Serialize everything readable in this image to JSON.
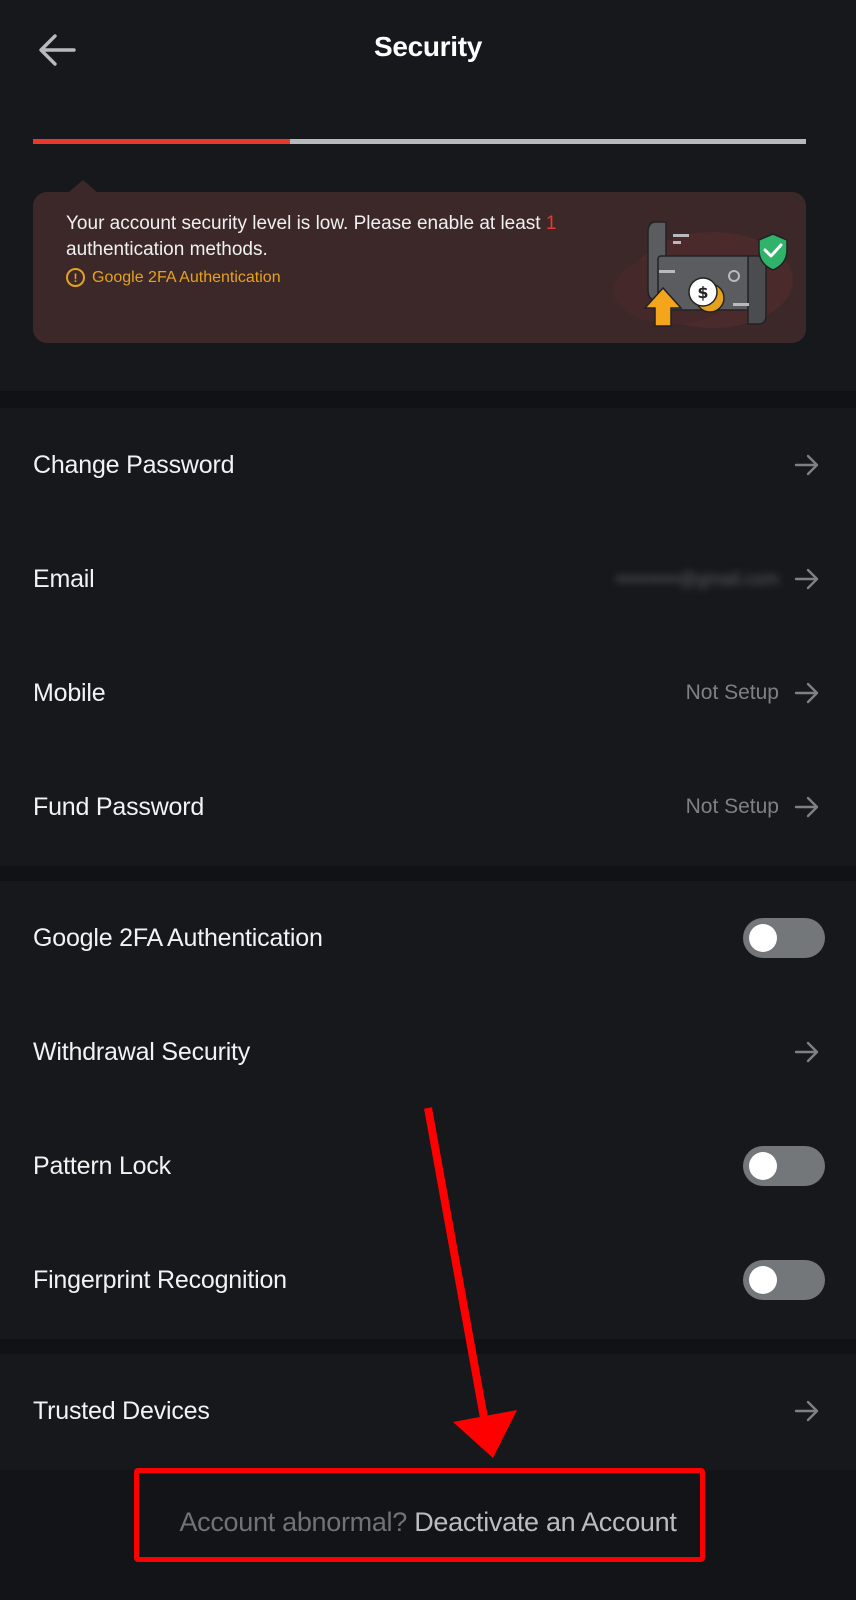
{
  "header": {
    "title": "Security",
    "back_icon": "arrow-left-icon"
  },
  "security_level": {
    "progress_fraction": 0.333,
    "fill_color": "#e8392f",
    "track_color": "#b7b9bd"
  },
  "alert": {
    "message_prefix": "Your account security level is low. Please enable at least ",
    "message_count": "1",
    "message_suffix": " authentication methods.",
    "link_label": "Google 2FA Authentication",
    "link_icon": "warning-circle-icon",
    "illustration": "wallet-shield-upgrade-illustration"
  },
  "sections": [
    {
      "rows": [
        {
          "label": "Change Password",
          "value": "",
          "control": "arrow"
        },
        {
          "label": "Email",
          "value": "••••••••••@gmail.com",
          "value_blurred": true,
          "control": "arrow"
        },
        {
          "label": "Mobile",
          "value": "Not Setup",
          "control": "arrow"
        },
        {
          "label": "Fund Password",
          "value": "Not Setup",
          "control": "arrow"
        }
      ]
    },
    {
      "rows": [
        {
          "label": "Google 2FA Authentication",
          "control": "toggle",
          "enabled": false
        },
        {
          "label": "Withdrawal Security",
          "control": "arrow"
        },
        {
          "label": "Pattern Lock",
          "control": "toggle",
          "enabled": false
        },
        {
          "label": "Fingerprint Recognition",
          "control": "toggle",
          "enabled": false
        }
      ]
    },
    {
      "rows": [
        {
          "label": "Trusted Devices",
          "control": "arrow"
        }
      ]
    }
  ],
  "footer": {
    "question": "Account abnormal?",
    "link_label": "Deactivate an Account"
  },
  "annotation": {
    "color": "#ff0000",
    "target": "Deactivate an Account"
  }
}
